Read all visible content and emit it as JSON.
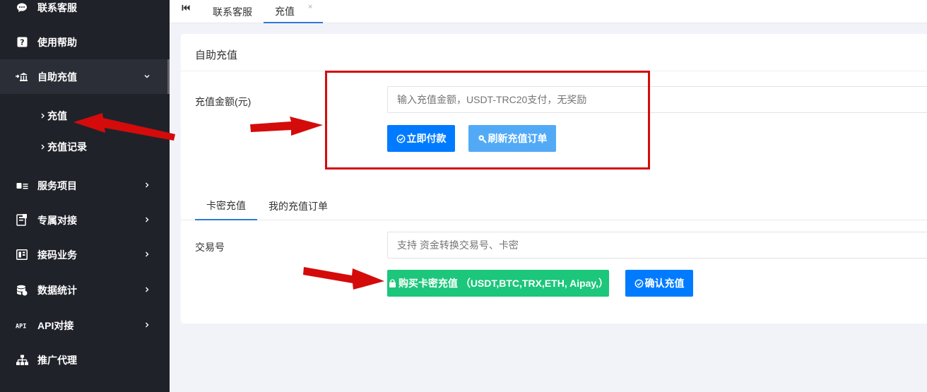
{
  "sidebar": {
    "items": [
      {
        "label": "联系客服",
        "icon": "chat-icon"
      },
      {
        "label": "使用帮助",
        "icon": "help-icon"
      },
      {
        "label": "自助充值",
        "icon": "bank-icon"
      },
      {
        "label": "服务项目",
        "icon": "card-icon"
      },
      {
        "label": "专属对接",
        "icon": "document-icon"
      },
      {
        "label": "接码业务",
        "icon": "phone-code-icon"
      },
      {
        "label": "数据统计",
        "icon": "database-icon"
      },
      {
        "label": "API对接",
        "icon": "api-icon"
      },
      {
        "label": "推广代理",
        "icon": "sitemap-icon"
      }
    ],
    "sub_items": [
      {
        "label": "充值"
      },
      {
        "label": "充值记录"
      }
    ]
  },
  "tabbar": {
    "tabs": [
      {
        "label": "联系客服"
      },
      {
        "label": "充值"
      }
    ],
    "close_label": "×"
  },
  "card": {
    "title": "自助充值",
    "amount_label": "充值金额(元)",
    "amount_placeholder": "输入充值金额，USDT-TRC20支付，无奖励",
    "pay_button": "立即付款",
    "refresh_button": "刷新充值订单",
    "subtabs": [
      {
        "label": "卡密充值"
      },
      {
        "label": "我的充值订单"
      }
    ],
    "trade_label": "交易号",
    "trade_placeholder": "支持 资金转换交易号、卡密",
    "buy_button": "购买卡密充值 （USDT,BTC,TRX,ETH, Aipay,）",
    "confirm_button": "确认充值"
  },
  "colors": {
    "sidebar_bg": "#20222a",
    "primary": "#007bff",
    "light_primary": "#52aaf7",
    "success": "#1cc67b",
    "annotation": "#d40b0b"
  }
}
